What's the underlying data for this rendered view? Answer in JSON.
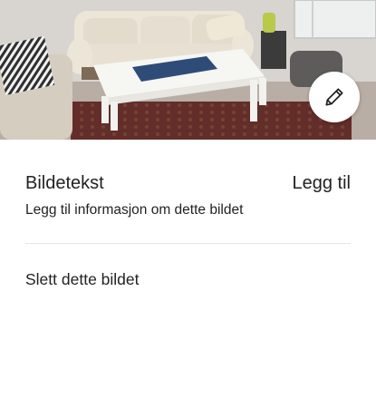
{
  "photo": {
    "icon": "pencil-icon"
  },
  "caption": {
    "title": "Bildetekst",
    "add_label": "Legg til",
    "hint": "Legg til informasjon om dette bildet"
  },
  "actions": {
    "delete_label": "Slett dette bildet"
  }
}
